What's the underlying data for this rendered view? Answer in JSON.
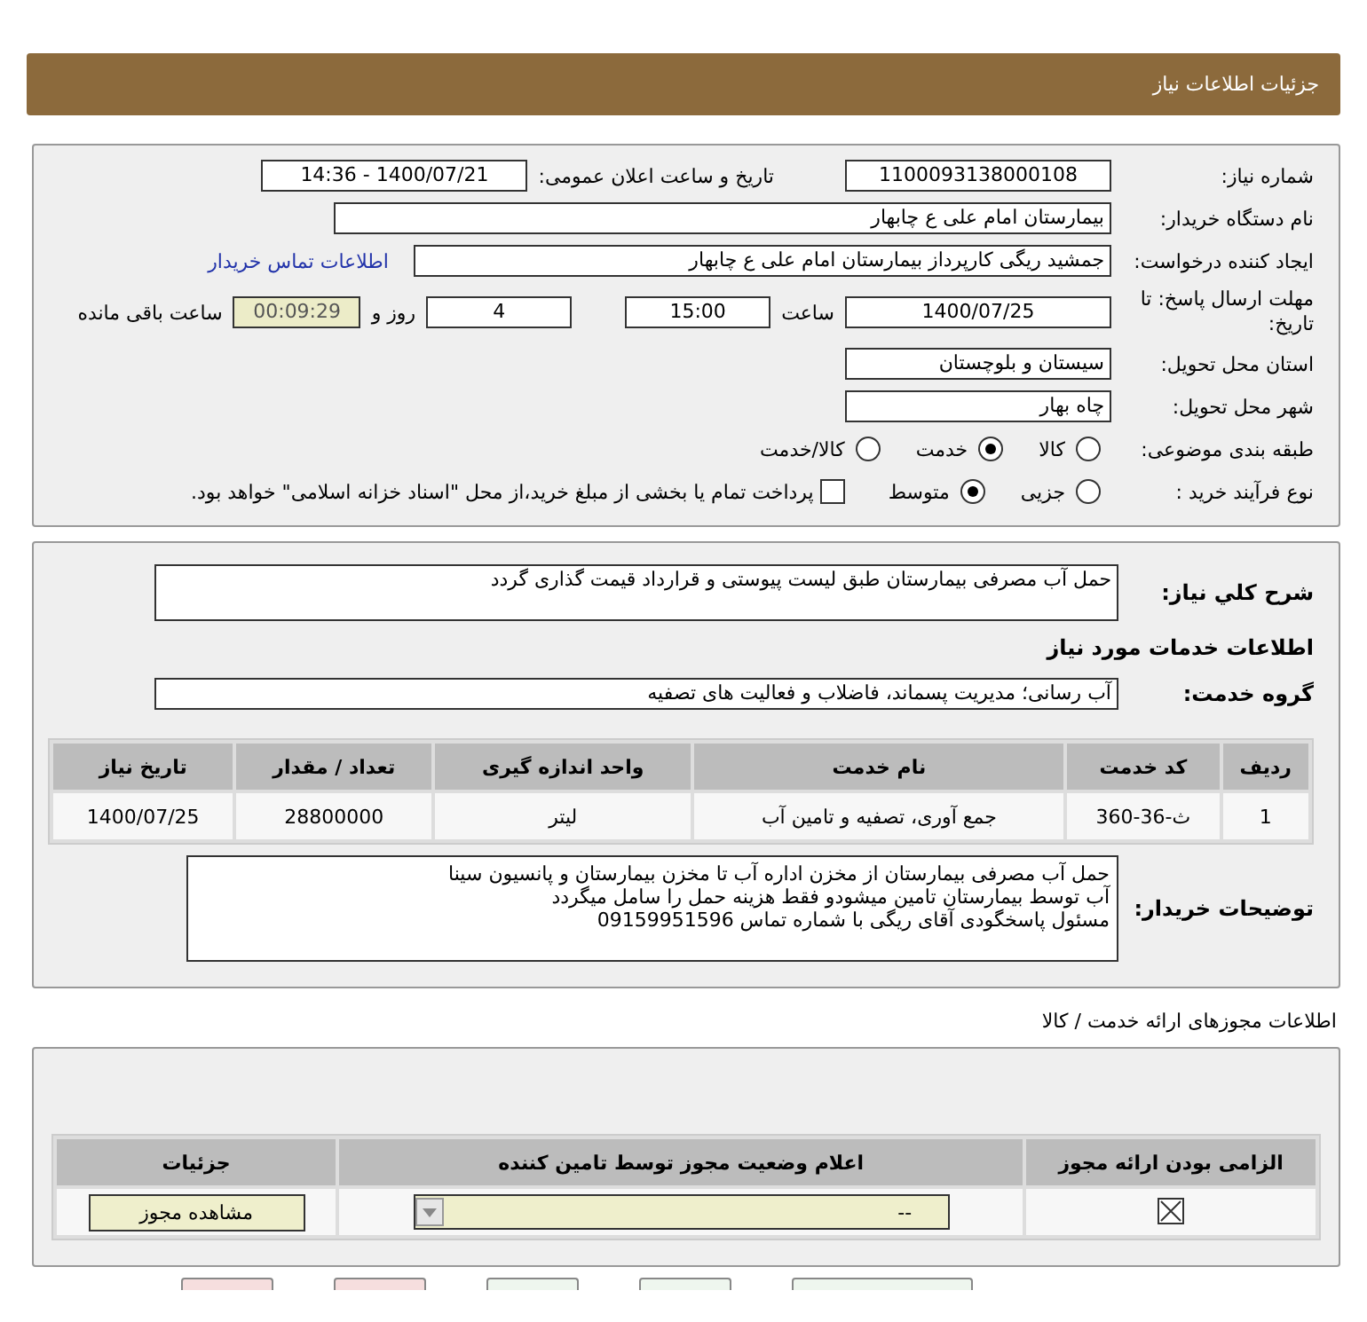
{
  "header": {
    "title": "جزئیات اطلاعات نیاز"
  },
  "details": {
    "need_number_label": "شماره نیاز:",
    "need_number": "1100093138000108",
    "announce_label": "تاریخ و ساعت اعلان عمومی:",
    "announce_value": "1400/07/21 - 14:36",
    "buyer_label": "نام دستگاه خریدار:",
    "buyer": "بیمارستان امام علی  ع  چابهار",
    "creator_label": "ایجاد کننده درخواست:",
    "creator": "جمشید ریگی کارپرداز بیمارستان امام علی  ع  چابهار",
    "contact_link": "اطلاعات تماس خریدار",
    "deadline_label": "مهلت ارسال پاسخ: تا تاریخ:",
    "deadline_date": "1400/07/25",
    "time_label": "ساعت",
    "deadline_time": "15:00",
    "days": "4",
    "days_label": "روز و",
    "remaining": "00:09:29",
    "remaining_label": "ساعت باقی مانده",
    "province_label": "استان محل تحویل:",
    "province": "سیستان و بلوچستان",
    "city_label": "شهر محل تحویل:",
    "city": "چاه بهار",
    "category_label": "طبقه بندی موضوعی:",
    "category_options": [
      {
        "label": "کالا",
        "selected": false
      },
      {
        "label": "خدمت",
        "selected": true
      },
      {
        "label": "کالا/خدمت",
        "selected": false
      }
    ],
    "process_label": "نوع فرآیند خرید :",
    "process_options": [
      {
        "label": "جزیی",
        "selected": false
      },
      {
        "label": "متوسط",
        "selected": true
      }
    ],
    "payment": {
      "label": "پرداخت تمام یا بخشی از مبلغ خرید،از محل \"اسناد خزانه اسلامی\" خواهد بود.",
      "checked": false
    }
  },
  "need": {
    "description_label": "شرح کلي نياز:",
    "description": "حمل آب مصرفی بیمارستان طبق لیست پیوستی و قرارداد قیمت گذاری گردد",
    "services_title": "اطلاعات خدمات مورد نیاز",
    "group_label": "گروه خدمت:",
    "group": "آب رسانی؛ مدیریت پسماند، فاضلاب و فعالیت های تصفیه",
    "table": {
      "columns": [
        "ردیف",
        "کد خدمت",
        "نام خدمت",
        "واحد اندازه گیری",
        "تعداد / مقدار",
        "تاریخ نیاز"
      ],
      "rows": [
        [
          "1",
          "ث-36-360",
          "جمع آوری، تصفیه و تامین آب",
          "لیتر",
          "28800000",
          "1400/07/25"
        ]
      ]
    },
    "notes_label": "توضیحات خریدار:",
    "notes": [
      "حمل آب مصرفی بیمارستان از مخزن اداره آب تا مخزن بیمارستان و پانسیون سینا",
      "آب توسط بیمارستان تامین میشودو فقط هزینه حمل را سامل میگردد",
      "مسئول پاسخگودی آقای ریگی با شماره تماس 09159951596"
    ]
  },
  "permits": {
    "title": "اطلاعات مجوزهای ارائه خدمت / کالا",
    "columns": [
      "الزامی بودن ارائه مجوز",
      "اعلام وضعیت مجوز توسط تامین کننده",
      "جزئیات"
    ],
    "row": {
      "required": true,
      "status": "--",
      "button": "مشاهده مجوز"
    }
  },
  "footer_buttons": [
    {
      "kind": "pink"
    },
    {
      "kind": "pink"
    },
    {
      "kind": "green"
    },
    {
      "kind": "green"
    },
    {
      "kind": "green"
    }
  ]
}
